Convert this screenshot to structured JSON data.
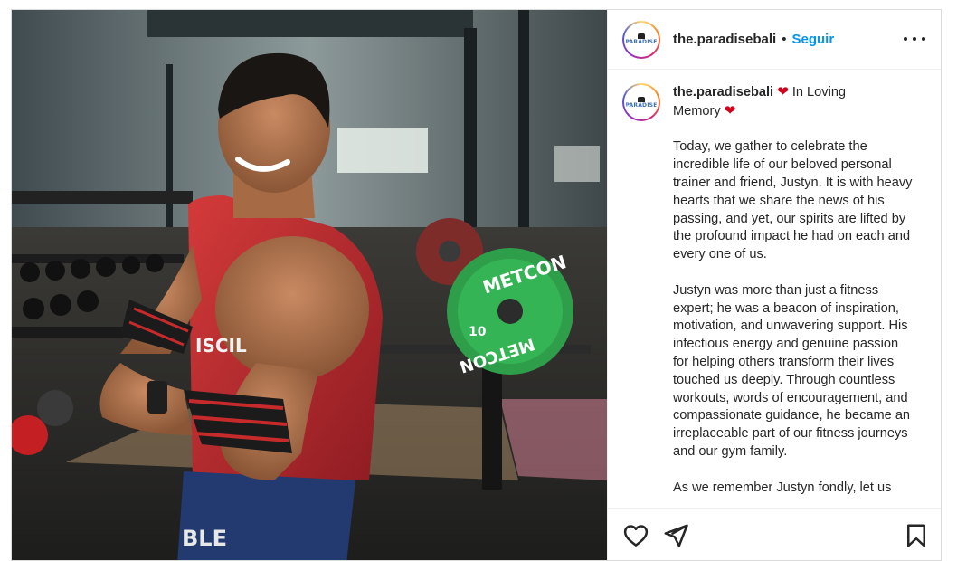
{
  "post": {
    "username": "the.paradisebali",
    "separator": "•",
    "follow_label": "Seguir",
    "avatar_text": "PARADISE",
    "photo_print": {
      "shirt_text": "ISCIL",
      "shorts_text": "BLE",
      "plate_text": "METCON",
      "plate_weight": "10"
    }
  },
  "caption": {
    "username": "the.paradisebali",
    "heading_text": " In Loving",
    "heading_text2": "Memory",
    "paragraph1": "Today, we gather to celebrate the incredible life of our beloved personal trainer and friend, Justyn. It is with heavy hearts that we share the news of his passing, and yet, our spirits are lifted by the profound impact he had on each and every one of us.",
    "paragraph2": "Justyn was more than just a fitness expert; he was a beacon of inspiration, motivation, and unwavering support. His infectious energy and genuine passion for helping others transform their lives touched us deeply. Through countless workouts, words of encouragement, and compassionate guidance, he became an irreplaceable part of our fitness journeys and our gym family.",
    "paragraph3": "As we remember Justyn fondly, let us"
  },
  "colors": {
    "accent": "#0095f6",
    "heart": "#d0021b",
    "text": "#262626"
  },
  "icons": {
    "like": "heart-outline-icon",
    "share": "paper-plane-icon",
    "save": "bookmark-icon",
    "more": "more-horizontal-icon"
  }
}
